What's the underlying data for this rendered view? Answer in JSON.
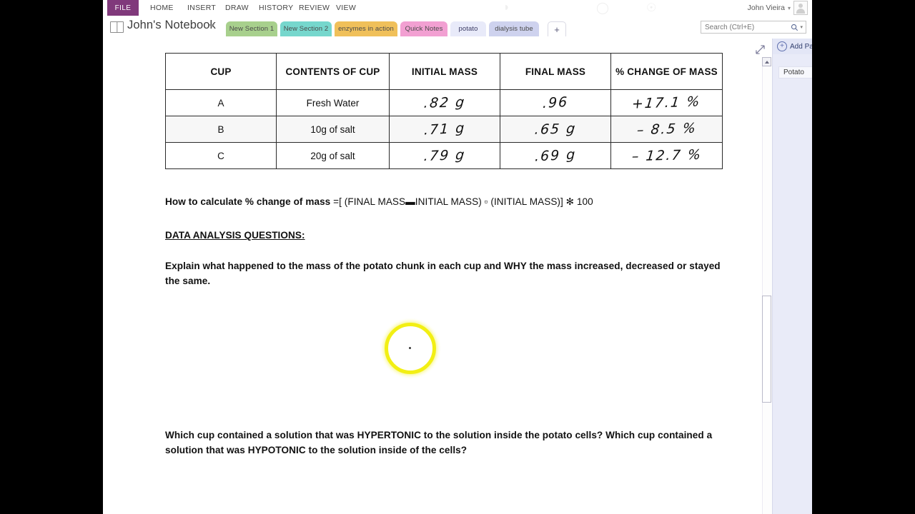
{
  "window": {
    "user_name": "John Vieira",
    "user_caret": "▾"
  },
  "ribbon": {
    "file_label": "FILE",
    "tabs": [
      {
        "label": "HOME"
      },
      {
        "label": "INSERT"
      },
      {
        "label": "DRAW"
      },
      {
        "label": "HISTORY"
      },
      {
        "label": "REVIEW"
      },
      {
        "label": "VIEW"
      }
    ]
  },
  "notebook": {
    "title": "John's Notebook",
    "caret": "▾",
    "icon": "notebook-icon",
    "sections": [
      {
        "label": "New Section 1",
        "color": "#a8d08d",
        "active": false
      },
      {
        "label": "New Section 2",
        "color": "#76d7cd",
        "active": false
      },
      {
        "label": "enzymes in action",
        "color": "#f0c05a",
        "active": false
      },
      {
        "label": "Quick Notes",
        "color": "#f2a0d2",
        "active": false
      },
      {
        "label": "potato",
        "color": "#e8eaf9",
        "active": true
      },
      {
        "label": "dialysis tube",
        "color": "#ced2ee",
        "active": false
      }
    ],
    "add_section_label": "+"
  },
  "search": {
    "placeholder": "Search (Ctrl+E)",
    "value": "",
    "icon": "search-icon",
    "caret": "▾"
  },
  "pagelist": {
    "add_page_label": "Add Pa",
    "add_page_icon": "+",
    "pages": [
      {
        "label": "Potato",
        "active": true
      }
    ]
  },
  "scroll": {
    "up_arrow": "▲"
  },
  "note": {
    "table": {
      "headers": [
        "CUP",
        "CONTENTS OF CUP",
        "INITIAL MASS",
        "FINAL MASS",
        "% CHANGE OF MASS"
      ],
      "rows": [
        {
          "cup": "A",
          "contents": "Fresh Water",
          "initial": ".82 g",
          "final": ".96",
          "change": "+17.1 %"
        },
        {
          "cup": "B",
          "contents": "10g of salt",
          "initial": ".71 g",
          "final": ".65 g",
          "change": "– 8.5 %"
        },
        {
          "cup": "C",
          "contents": "20g of salt",
          "initial": ".79 g",
          "final": ".69 g",
          "change": "– 12.7 %"
        }
      ]
    },
    "formula_label": "How to calculate % change of mass",
    "formula_body": " =[ (FINAL MASS▬INITIAL MASS) ▫ (INITIAL MASS)] ✻ 100",
    "data_analysis_heading": "DATA ANALYSIS QUESTIONS:",
    "question_1": "Explain what happened to the mass of the potato chunk in each cup and WHY the mass increased, decreased or stayed the same.",
    "question_2": "Which cup contained a solution that was HYPERTONIC to the solution inside the potato cells?  Which cup contained a solution that was HYPOTONIC to the solution inside of the cells?"
  },
  "annotation": {
    "click_ring_color": "#f2ef14"
  }
}
